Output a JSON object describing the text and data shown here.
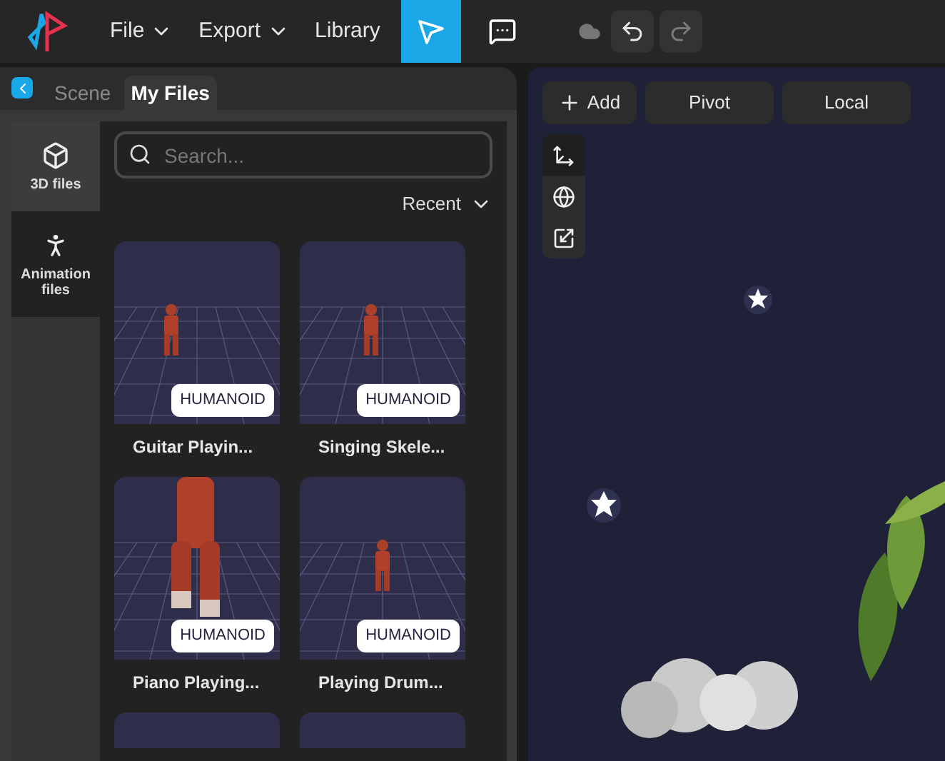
{
  "menu": [
    {
      "label": "File",
      "dropdown": true
    },
    {
      "label": "Export",
      "dropdown": true
    },
    {
      "label": "Library",
      "dropdown": false
    }
  ],
  "tools": [
    {
      "kind": "select",
      "selected": true
    },
    {
      "kind": "comment",
      "selected": false
    }
  ],
  "history": [
    {
      "kind": "undo",
      "disabled": false
    },
    {
      "kind": "redo",
      "disabled": true
    }
  ],
  "panel_tabs": [
    {
      "label": "Scene",
      "selected": false
    },
    {
      "label": "My Files",
      "selected": true
    }
  ],
  "sidebar": {
    "items": [
      {
        "kind": "model",
        "label": "3D files",
        "selected": true
      },
      {
        "kind": "animation",
        "label": "Animation files",
        "selected": false
      }
    ]
  },
  "search": {
    "placeholder": "Search..."
  },
  "sort": {
    "label": "Recent"
  },
  "files": [
    {
      "kind": "model",
      "badge": "HUMANOID",
      "name": "Guitar Playin..."
    },
    {
      "kind": "model",
      "badge": "HUMANOID",
      "name": "Singing Skele..."
    },
    {
      "kind": "model",
      "badge": "HUMANOID",
      "name": "Piano Playing..."
    },
    {
      "kind": "model",
      "badge": "HUMANOID",
      "name": "Playing Drum..."
    },
    {
      "kind": "partial"
    },
    {
      "kind": "partial"
    }
  ],
  "viewport": {
    "buttons": [
      {
        "kind": "add",
        "label": "Add"
      },
      {
        "kind": "plain",
        "label": "Pivot"
      },
      {
        "kind": "plain",
        "label": "Local"
      }
    ],
    "gizmos": [
      {
        "kind": "move",
        "selected": true
      },
      {
        "kind": "rotate",
        "selected": false
      },
      {
        "kind": "scale",
        "selected": false
      }
    ]
  }
}
